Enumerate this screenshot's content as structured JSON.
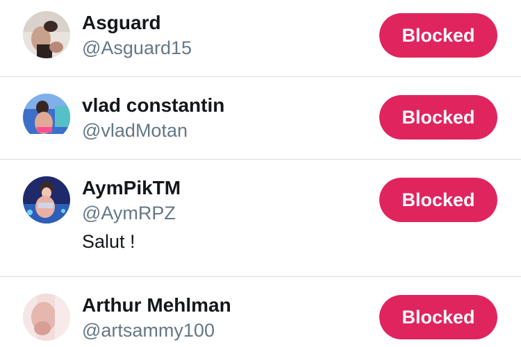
{
  "blocked_accounts": [
    {
      "name": "Asguard",
      "handle": "@Asguard15",
      "bio": "",
      "button_label": "Blocked",
      "avatar_icon": "user-avatar-photo"
    },
    {
      "name": "vlad constantin",
      "handle": "@vladMotan",
      "bio": "",
      "button_label": "Blocked",
      "avatar_icon": "user-avatar-photo"
    },
    {
      "name": "AymPikTM",
      "handle": "@AymRPZ",
      "bio": "Salut !",
      "button_label": "Blocked",
      "avatar_icon": "user-avatar-photo"
    },
    {
      "name": "Arthur Mehlman",
      "handle": "@artsammy100",
      "bio": "",
      "button_label": "Blocked",
      "avatar_icon": "user-avatar-photo"
    }
  ],
  "colors": {
    "blocked_button": "#e0245e",
    "name_text": "#14171a",
    "handle_text": "#657786",
    "divider": "#d9dce0"
  }
}
